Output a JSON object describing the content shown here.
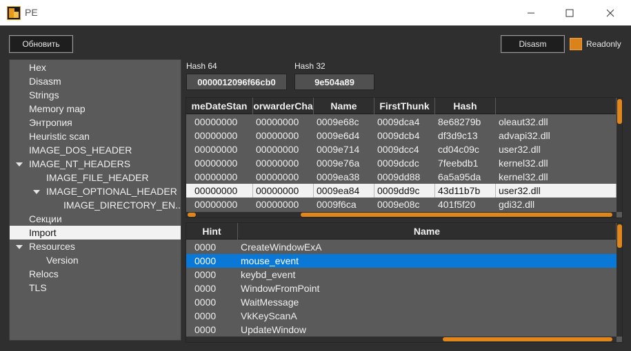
{
  "window": {
    "title": "PE",
    "minimize": "minimize",
    "maximize": "maximize",
    "close": "close"
  },
  "toolbar": {
    "refresh_label": "Обновить",
    "disasm_label": "Disasm",
    "readonly_label": "Readonly",
    "readonly_checked": true
  },
  "tree": {
    "items": [
      {
        "label": "Hex",
        "level": 0,
        "selected": false
      },
      {
        "label": "Disasm",
        "level": 0,
        "selected": false
      },
      {
        "label": "Strings",
        "level": 0,
        "selected": false
      },
      {
        "label": "Memory map",
        "level": 0,
        "selected": false
      },
      {
        "label": "Энтропия",
        "level": 0,
        "selected": false
      },
      {
        "label": "Heuristic scan",
        "level": 0,
        "selected": false
      },
      {
        "label": "IMAGE_DOS_HEADER",
        "level": 0,
        "selected": false
      },
      {
        "label": "IMAGE_NT_HEADERS",
        "level": 0,
        "selected": false
      },
      {
        "label": "IMAGE_FILE_HEADER",
        "level": 1,
        "selected": false
      },
      {
        "label": "IMAGE_OPTIONAL_HEADER",
        "level": 1,
        "selected": false
      },
      {
        "label": "IMAGE_DIRECTORY_EN...",
        "level": 2,
        "selected": false
      },
      {
        "label": "Секции",
        "level": 0,
        "selected": false
      },
      {
        "label": "Import",
        "level": 0,
        "selected": true
      },
      {
        "label": "Resources",
        "level": 0,
        "selected": false
      },
      {
        "label": "Version",
        "level": 1,
        "selected": false
      },
      {
        "label": "Relocs",
        "level": 0,
        "selected": false
      },
      {
        "label": "TLS",
        "level": 0,
        "selected": false
      }
    ]
  },
  "hashes": {
    "hash64_label": "Hash 64",
    "hash64_value": "0000012096f66cb0",
    "hash32_label": "Hash 32",
    "hash32_value": "9e504a89"
  },
  "import_table": {
    "columns": [
      "TimeDateStamp",
      "ForwarderChain",
      "Name",
      "FirstThunk",
      "Hash",
      ""
    ],
    "columns_display": [
      "meDateStan",
      "orwarderCha",
      "Name",
      "FirstThunk",
      "Hash",
      ""
    ],
    "rows": [
      [
        "00000000",
        "00000000",
        "0009e68c",
        "0009dca4",
        "8e68279b",
        "oleaut32.dll"
      ],
      [
        "00000000",
        "00000000",
        "0009e6d4",
        "0009dcb4",
        "df3d9c13",
        "advapi32.dll"
      ],
      [
        "00000000",
        "00000000",
        "0009e714",
        "0009dcc4",
        "cd04c09c",
        "user32.dll"
      ],
      [
        "00000000",
        "00000000",
        "0009e76a",
        "0009dcdc",
        "7feebdb1",
        "kernel32.dll"
      ],
      [
        "00000000",
        "00000000",
        "0009ea38",
        "0009dd88",
        "6a5a95da",
        "kernel32.dll"
      ],
      [
        "00000000",
        "00000000",
        "0009ea84",
        "0009dd9c",
        "43d11b7b",
        "user32.dll"
      ],
      [
        "00000000",
        "00000000",
        "0009f6ca",
        "0009e08c",
        "401f5f20",
        "gdi32.dll"
      ]
    ],
    "selected_row": 5
  },
  "functions_table": {
    "columns": [
      "Hint",
      "Name"
    ],
    "rows": [
      [
        "0000",
        "CreateWindowExA"
      ],
      [
        "0000",
        "mouse_event"
      ],
      [
        "0000",
        "keybd_event"
      ],
      [
        "0000",
        "WindowFromPoint"
      ],
      [
        "0000",
        "WaitMessage"
      ],
      [
        "0000",
        "VkKeyScanA"
      ],
      [
        "0000",
        "UpdateWindow"
      ]
    ],
    "selected_row": 1
  },
  "colors": {
    "accent": "#e0861a",
    "selection_blue": "#0a78d7",
    "background": "#2f2f2f",
    "panel": "#5a5a5a"
  }
}
